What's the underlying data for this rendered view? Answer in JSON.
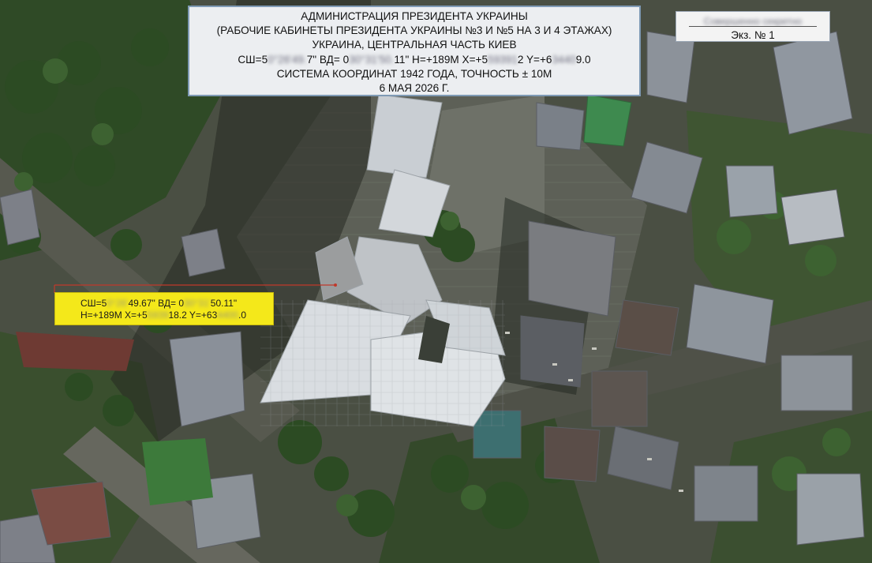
{
  "map": {
    "title_lines": [
      "АДМИНИСТРАЦИЯ ПРЕЗИДЕНТА УКРАИНЫ",
      "(РАБОЧИЕ КАБИНЕТЫ ПРЕЗИДЕНТА УКРАИНЫ №3 И №5 НА 3 И 4 ЭТАЖАХ)",
      "УКРАИНА, ЦЕНТРАЛЬНАЯ ЧАСТЬ КИЕВ"
    ],
    "coords_line": {
      "sh_prefix": "СШ=5",
      "sh_hidden": "0°26'49.",
      "sh_suffix": "7\"",
      "vd_prefix": " ВД= 0",
      "vd_hidden": "30°31'50.",
      "vd_suffix": "11\"",
      "h_x_prefix": " H=+189M X=+5",
      "x_hidden": "59391",
      "x_suffix": "2",
      "y_prefix": " Y=+6",
      "y_hidden": "3440",
      "y_suffix": "9.0"
    },
    "system_line": "СИСТЕМА КООРДИНАТ 1942 ГОДА, ТОЧНОСТЬ ± 10М",
    "date_line": "6 МАЯ 2026 Г.",
    "copy_label_hidden": "Совершенно секретно",
    "copy_number": "Экз. № 1"
  },
  "target": {
    "line1": {
      "sh_prefix": "СШ=5",
      "sh_hidden": "0°26'",
      "sh_suffix": "49.67\"",
      "vd_prefix": " ВД= 0",
      "vd_hidden": "30°31'",
      "vd_suffix": "50.11\""
    },
    "line2": {
      "h_x_prefix": "H=+189M X=+5",
      "x_hidden": "5939",
      "x_suffix": "18.2",
      "y_prefix": " Y=+63",
      "y_hidden": "4400",
      "y_suffix": ".0"
    }
  },
  "colors": {
    "overlay_border": "#7f9ab5",
    "marker_yellow": "#f4e81a",
    "pointer_red": "#c0392b"
  }
}
